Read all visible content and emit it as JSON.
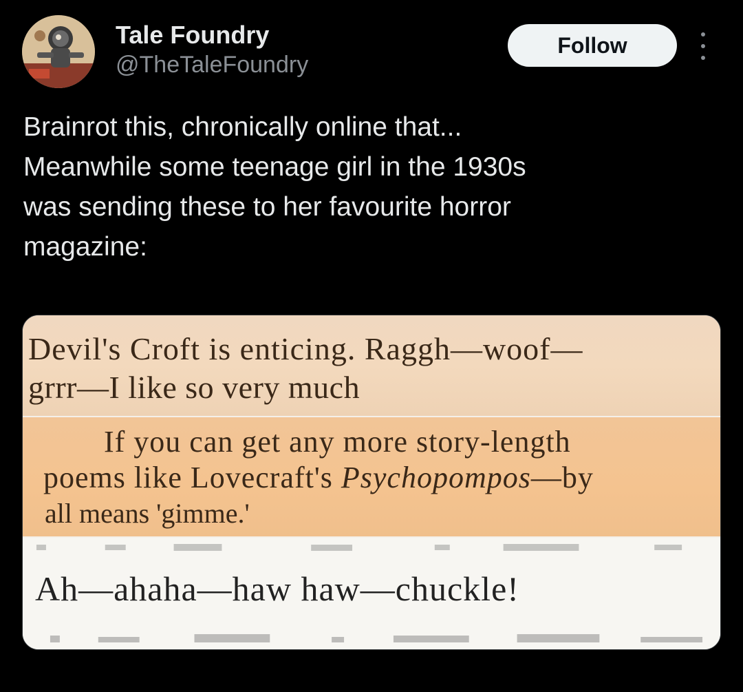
{
  "author": {
    "display_name": "Tale Foundry",
    "handle": "@TheTaleFoundry",
    "avatar_icon": "avatar-robot-illustration"
  },
  "actions": {
    "follow_label": "Follow",
    "more_icon": "more-vertical-icon"
  },
  "post": {
    "text": "Brainrot this, chronically online that...\nMeanwhile some teenage girl in  the 1930s\nwas sending these to her favourite horror\nmagazine:"
  },
  "media": {
    "clip1": {
      "line1": "Devil's Croft is enticing.  Raggh—woof—",
      "line2": "grrr—I like so very much"
    },
    "clip2": {
      "line1": "If you can get any more story-length",
      "line2_a": "poems like Lovecraft's ",
      "line2_italic": "Psychopompos",
      "line2_b": "—by",
      "line3": "all means 'gimme.'"
    },
    "clip3": {
      "line1": "Ah—ahaha—haw haw—chuckle!"
    }
  },
  "colors": {
    "background": "#000000",
    "follow_bg": "#eff3f4",
    "clip1_bg": "#f3d9bd",
    "clip2_bg": "#f4c38f",
    "clip3_bg": "#f7f6f2"
  }
}
